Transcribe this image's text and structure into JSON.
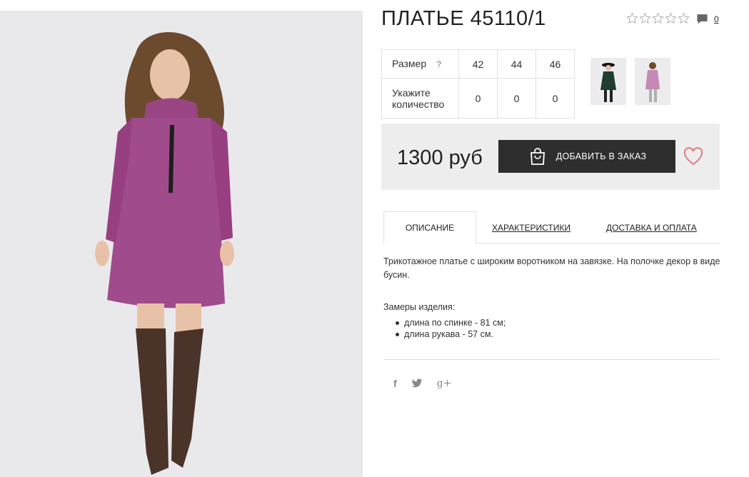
{
  "product": {
    "title": "ПЛАТЬЕ 45110/1",
    "rating": 0,
    "comments_count": "0"
  },
  "size_table": {
    "size_label": "Размер",
    "help_mark": "?",
    "sizes": [
      "42",
      "44",
      "46"
    ],
    "quantity_label_line1": "Укажите",
    "quantity_label_line2": "количество",
    "quantities": [
      "0",
      "0",
      "0"
    ]
  },
  "thumbnails": [
    {
      "name": "dress-green-thumbnail"
    },
    {
      "name": "dress-pink-thumbnail"
    }
  ],
  "purchase": {
    "price": "1300 руб",
    "add_to_order_label": "ДОБАВИТЬ В ЗАКАЗ"
  },
  "tabs": [
    {
      "label": "ОПИСАНИЕ",
      "active": true
    },
    {
      "label": "ХАРАКТЕРИСТИКИ",
      "active": false
    },
    {
      "label": "ДОСТАВКА И ОПЛАТА",
      "active": false
    }
  ],
  "description": {
    "text": "Трикотажное платье с широким воротником на завязке. На полочке декор в виде бусин.",
    "measures_title": "Замеры изделия:",
    "measures": [
      "длина по спинке - 81 см;",
      "длина рукава - 57 см."
    ]
  },
  "social": {
    "facebook": "f",
    "twitter": "twitter-icon",
    "google_plus": "g+"
  },
  "colors": {
    "dark_button": "#2e2e2e",
    "heart": "#e07b86",
    "dress": "#a04b8c",
    "panel": "#ededed"
  }
}
